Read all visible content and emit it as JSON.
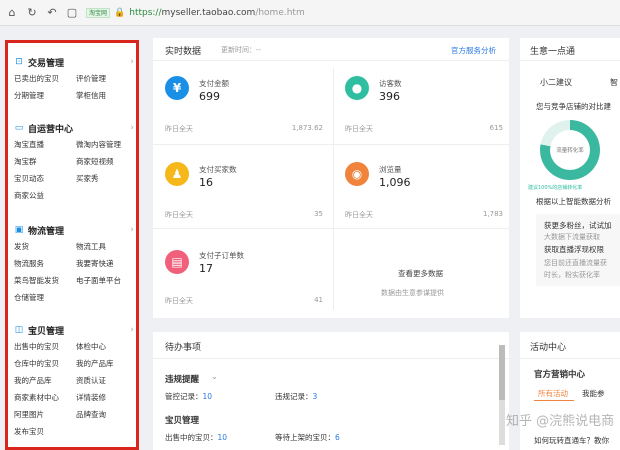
{
  "browser": {
    "badge": "淘宝网",
    "url_prefix": "https://",
    "url_host": "myseller.taobao.com",
    "url_path": "/home.htm"
  },
  "sidebar": {
    "sections": [
      {
        "title": "交易管理",
        "icon": "money-icon",
        "links": [
          "已卖出的宝贝",
          "评价管理",
          "分期管理",
          "掌柜信用"
        ]
      },
      {
        "title": "自运营中心",
        "icon": "chat-icon",
        "links": [
          "淘宝直播",
          "微淘内容管理",
          "淘宝群",
          "商家短视频",
          "宝贝动态",
          "买家秀",
          "商家公益"
        ]
      },
      {
        "title": "物流管理",
        "icon": "truck-icon",
        "links": [
          "发货",
          "物流工具",
          "物流服务",
          "我要寄快递",
          "菜鸟智能发货",
          "电子面单平台",
          "仓储管理"
        ]
      },
      {
        "title": "宝贝管理",
        "icon": "bag-icon",
        "links": [
          "出售中的宝贝",
          "体检中心",
          "仓库中的宝贝",
          "我的产品库",
          "我的产品库",
          "资质认证",
          "商家素材中心",
          "详情装修",
          "阿里图片",
          "品牌查询",
          "发布宝贝"
        ]
      }
    ]
  },
  "realtime": {
    "title": "实时数据",
    "update_label": "更新时间：",
    "update_value": "--",
    "link": "官方服务分析",
    "stats": [
      {
        "label": "支付金额",
        "value": "699",
        "foot": "昨日全天",
        "foot_value": "1,873.62",
        "color": "#1a8fe6",
        "icon": "yen-icon",
        "glyph": "¥"
      },
      {
        "label": "访客数",
        "value": "396",
        "foot": "昨日全天",
        "foot_value": "615",
        "color": "#2fbfa0",
        "icon": "visitors-icon",
        "glyph": "●"
      },
      {
        "label": "支付买家数",
        "value": "16",
        "foot": "昨日全天",
        "foot_value": "35",
        "color": "#f5b71a",
        "icon": "buyers-icon",
        "glyph": "♟"
      },
      {
        "label": "浏览量",
        "value": "1,096",
        "foot": "昨日全天",
        "foot_value": "1,783",
        "color": "#f0843c",
        "icon": "eye-icon",
        "glyph": "◉"
      },
      {
        "label": "支付子订单数",
        "value": "17",
        "foot": "昨日全天",
        "foot_value": "41",
        "color": "#f0607a",
        "icon": "orders-icon",
        "glyph": "▤"
      }
    ],
    "more_link": "查看更多数据",
    "more_note": "数据由生意参谋提供"
  },
  "advice": {
    "title": "生意一点通",
    "tabs": [
      "小二建议",
      "智"
    ],
    "text": "您与竞争店铺的对比建",
    "donut_label": "流量转化率",
    "donut_note": "建议100%的店铺转化率",
    "note": "根据以上智能数据分析",
    "lines": [
      "获更多粉丝，试试加",
      "大数据下流量获取",
      "获取直播浮现权限",
      "您目前还直播流量获",
      "时长，粉实获化率"
    ]
  },
  "todo": {
    "title": "待办事项",
    "violation_title": "违规提醒",
    "violation_items": [
      {
        "label": "管控记录：",
        "value": "10"
      },
      {
        "label": "违规记录：",
        "value": "3"
      }
    ],
    "goods_title": "宝贝管理",
    "goods_items": [
      {
        "label": "出售中的宝贝：",
        "value": "10"
      },
      {
        "label": "等待上架的宝贝：",
        "value": "6"
      }
    ]
  },
  "activity": {
    "title": "活动中心",
    "sub_title": "官方营销中心",
    "tabs": [
      "所有活动",
      "我能参"
    ],
    "footer": "如何玩转直通车？教你"
  },
  "watermark": "知乎 @浣熊说电商"
}
